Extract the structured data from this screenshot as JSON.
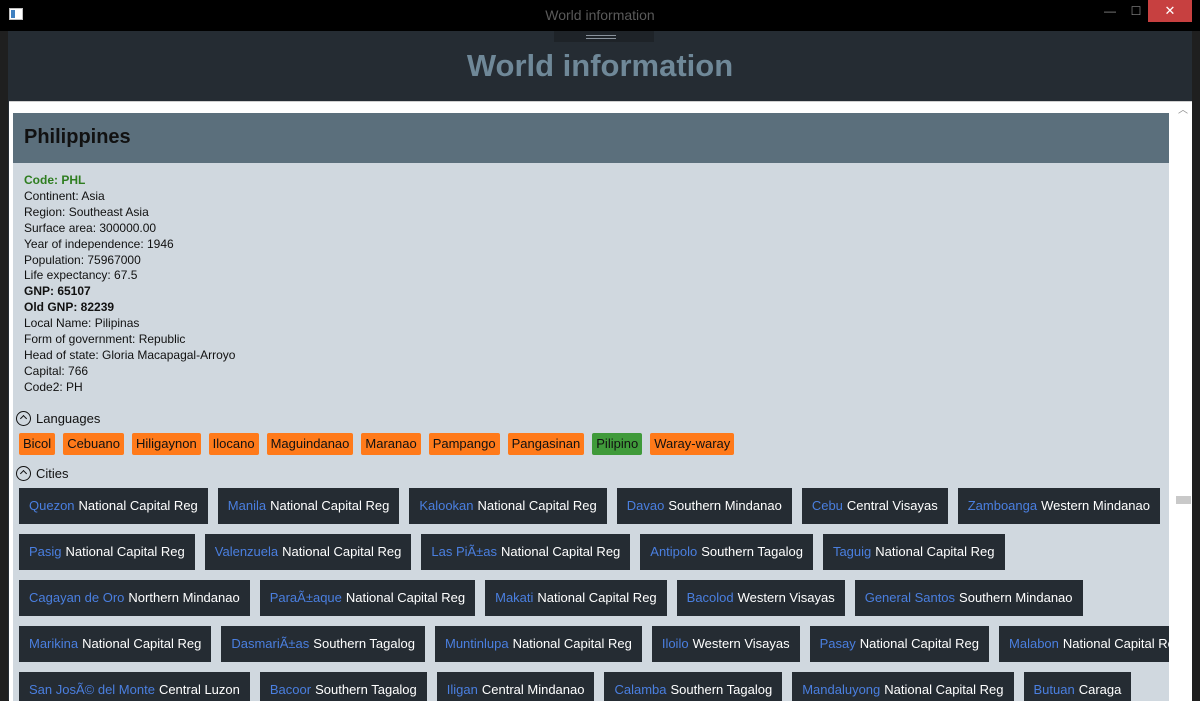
{
  "window": {
    "title": "World information",
    "min_glyph": "—",
    "max_glyph": "☐",
    "close_glyph": "✕"
  },
  "app": {
    "title": "World information"
  },
  "country": {
    "name": "Philippines",
    "code_line": "Code: PHL",
    "info_lines": [
      "Continent: Asia",
      "Region: Southeast Asia",
      "Surface area: 300000.00",
      "Year of independence: 1946",
      "Population: 75967000",
      "Life expectancy: 67.5"
    ],
    "gnp_line": "GNP: 65107",
    "old_gnp_line": "Old GNP: 82239",
    "extra_lines": [
      "Local Name: Pilipinas",
      "Form of government: Republic",
      "Head of state: Gloria Macapagal-Arroyo",
      "Capital: 766",
      "Code2: PH"
    ]
  },
  "languages": {
    "label": "Languages",
    "items": [
      {
        "name": "Bicol",
        "official": false
      },
      {
        "name": "Cebuano",
        "official": false
      },
      {
        "name": "Hiligaynon",
        "official": false
      },
      {
        "name": "Ilocano",
        "official": false
      },
      {
        "name": "Maguindanao",
        "official": false
      },
      {
        "name": "Maranao",
        "official": false
      },
      {
        "name": "Pampango",
        "official": false
      },
      {
        "name": "Pangasinan",
        "official": false
      },
      {
        "name": "Pilipino",
        "official": true
      },
      {
        "name": "Waray-waray",
        "official": false
      }
    ]
  },
  "cities": {
    "label": "Cities",
    "rows": [
      [
        {
          "name": "Quezon",
          "district": "National Capital Reg"
        },
        {
          "name": "Manila",
          "district": "National Capital Reg"
        },
        {
          "name": "Kalookan",
          "district": "National Capital Reg"
        },
        {
          "name": "Davao",
          "district": "Southern Mindanao"
        },
        {
          "name": "Cebu",
          "district": "Central Visayas"
        },
        {
          "name": "Zamboanga",
          "district": "Western Mindanao"
        }
      ],
      [
        {
          "name": "Pasig",
          "district": "National Capital Reg"
        },
        {
          "name": "Valenzuela",
          "district": "National Capital Reg"
        },
        {
          "name": "Las PiÃ±as",
          "district": "National Capital Reg"
        },
        {
          "name": "Antipolo",
          "district": "Southern Tagalog"
        },
        {
          "name": "Taguig",
          "district": "National Capital Reg"
        }
      ],
      [
        {
          "name": "Cagayan de Oro",
          "district": "Northern Mindanao"
        },
        {
          "name": "ParaÃ±aque",
          "district": "National Capital Reg"
        },
        {
          "name": "Makati",
          "district": "National Capital Reg"
        },
        {
          "name": "Bacolod",
          "district": "Western Visayas"
        },
        {
          "name": "General Santos",
          "district": "Southern Mindanao"
        }
      ],
      [
        {
          "name": "Marikina",
          "district": "National Capital Reg"
        },
        {
          "name": "DasmariÃ±as",
          "district": "Southern Tagalog"
        },
        {
          "name": "Muntinlupa",
          "district": "National Capital Reg"
        },
        {
          "name": "Iloilo",
          "district": "Western Visayas"
        },
        {
          "name": "Pasay",
          "district": "National Capital Reg"
        },
        {
          "name": "Malabon",
          "district": "National Capital Reg"
        }
      ],
      [
        {
          "name": "San JosÃ© del Monte",
          "district": "Central Luzon"
        },
        {
          "name": "Bacoor",
          "district": "Southern Tagalog"
        },
        {
          "name": "Iligan",
          "district": "Central Mindanao"
        },
        {
          "name": "Calamba",
          "district": "Southern Tagalog"
        },
        {
          "name": "Mandaluyong",
          "district": "National Capital Reg"
        },
        {
          "name": "Butuan",
          "district": "Caraga"
        }
      ]
    ]
  },
  "colors": {
    "accent_orange": "#ff7a1a",
    "official_green": "#3f9a3a",
    "city_name_blue": "#4a7fe0",
    "code_green": "#2e7d1f"
  }
}
